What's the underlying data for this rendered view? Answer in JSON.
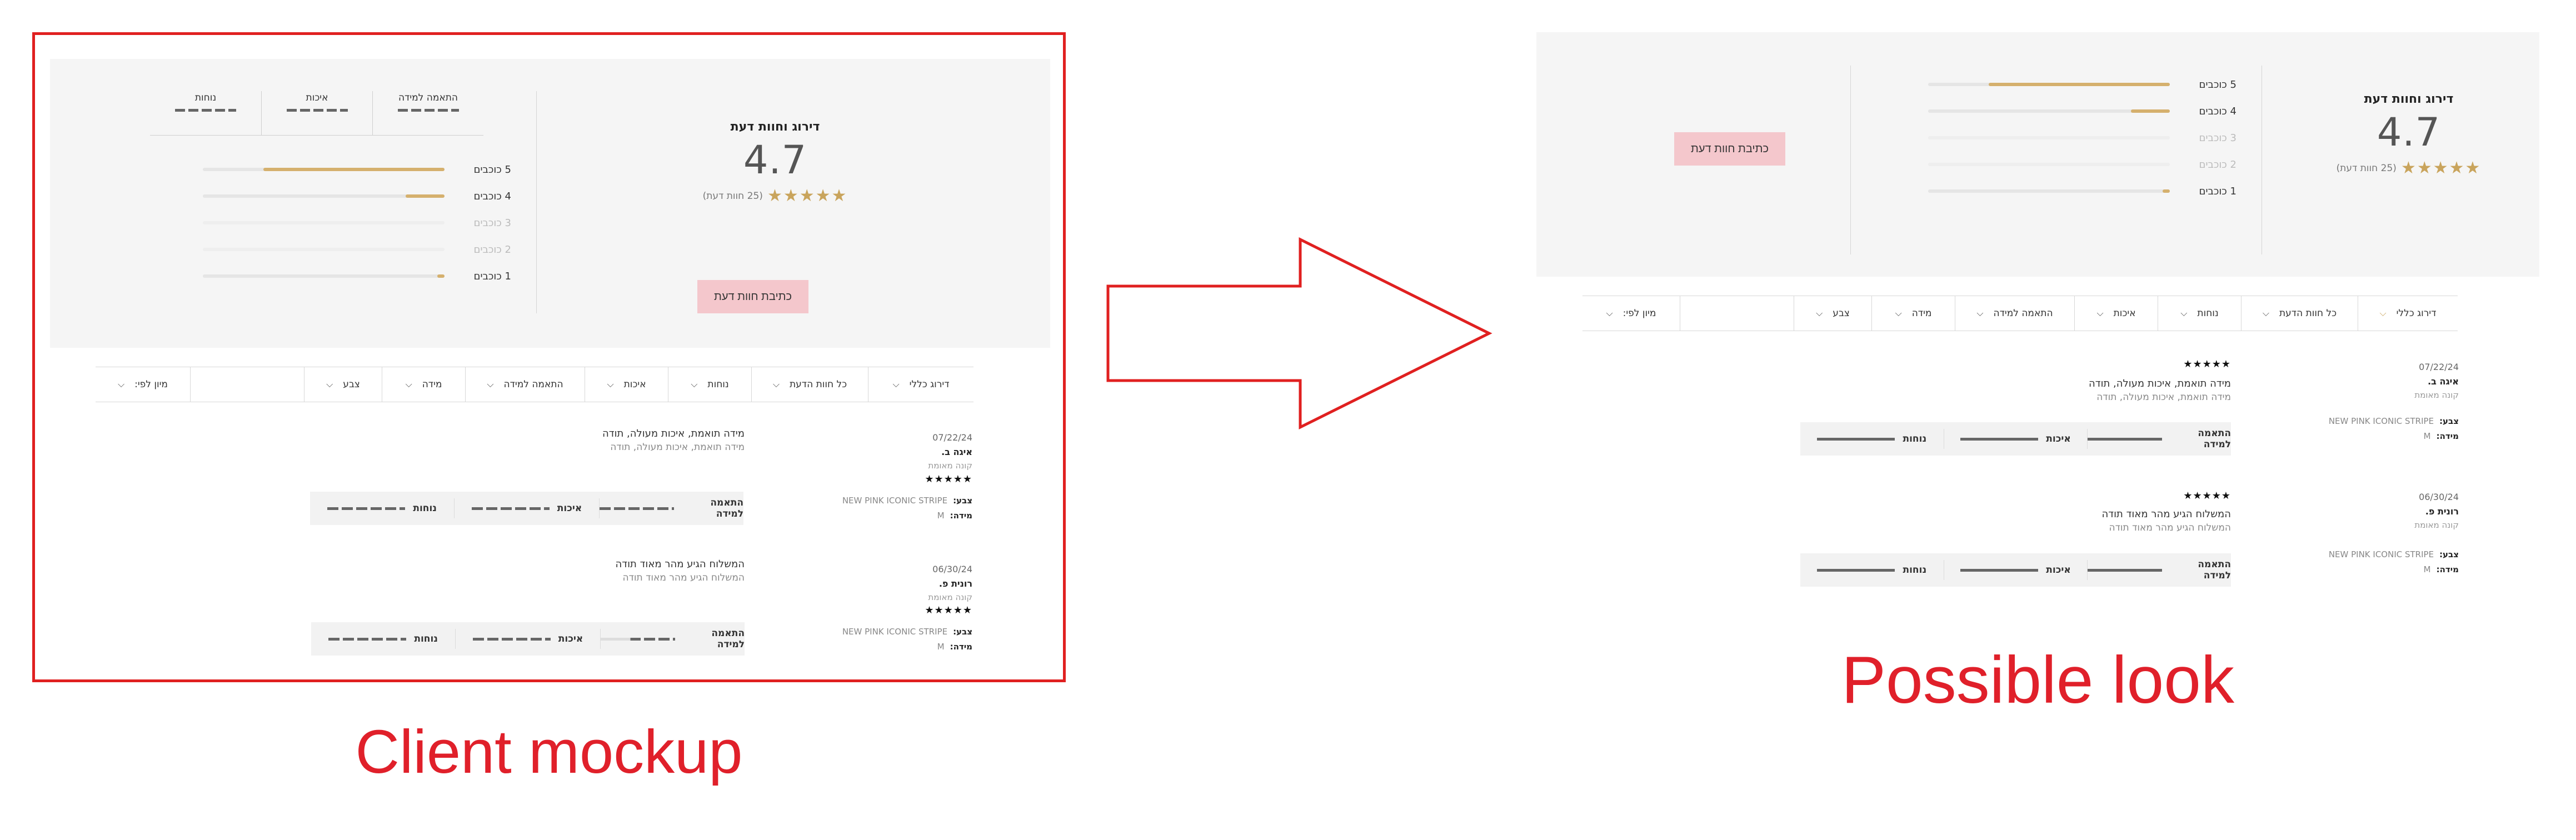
{
  "summary": {
    "title": "דירוג וחוות דעת",
    "rating": "4.7",
    "stars": "★★★★★",
    "count": "(25 חוות דעת)",
    "write_button": "כתיבת חוות דעת"
  },
  "distribution": [
    {
      "label": "5 כוכבים",
      "fraction": 0.75
    },
    {
      "label": "4 כוכבים",
      "fraction": 0.16
    },
    {
      "label": "3 כוכבים",
      "fraction": 0.0
    },
    {
      "label": "2 כוכבים",
      "fraction": 0.0
    },
    {
      "label": "1 כוכבים",
      "fraction": 0.03
    }
  ],
  "metrics": [
    "התאמה למידה",
    "איכות",
    "נוחות"
  ],
  "filters": {
    "overall": "דירוג כללי",
    "all_reviews": "כל חוות הדעת",
    "comfort": "נוחות",
    "quality": "איכות",
    "fit": "התאמה למידה",
    "size": "מידה",
    "color": "צבע",
    "sort": "מיון לפי:"
  },
  "reviews": [
    {
      "date": "07/22/24",
      "name": "איגה ב.",
      "verified": "קונה מאומת",
      "title": "מידה תואמת, איכות מעולה, תודה",
      "text": "מידה תואמת, איכות מעולה, תודה",
      "stars": "★★★★★",
      "color_label": "צבע:",
      "color_value": "NEW PINK ICONIC STRIPE",
      "size_label": "מידה:",
      "size_value": "M"
    },
    {
      "date": "06/30/24",
      "name": "רונית פ.",
      "verified": "קונה מאומת",
      "title": "המשלוח הגיע מהר מאוד תודה",
      "text": "המשלוח הגיע מהר מאוד תודה",
      "stars": "★★★★★",
      "color_label": "צבע:",
      "color_value": "NEW PINK ICONIC STRIPE",
      "size_label": "מידה:",
      "size_value": "M"
    }
  ],
  "captions": {
    "left": "Client mockup",
    "right": "Possible look"
  },
  "colors": {
    "frame": "#e02020",
    "gold": "#d5b06d",
    "button": "#f4c7cc",
    "caption": "#e0202a"
  }
}
